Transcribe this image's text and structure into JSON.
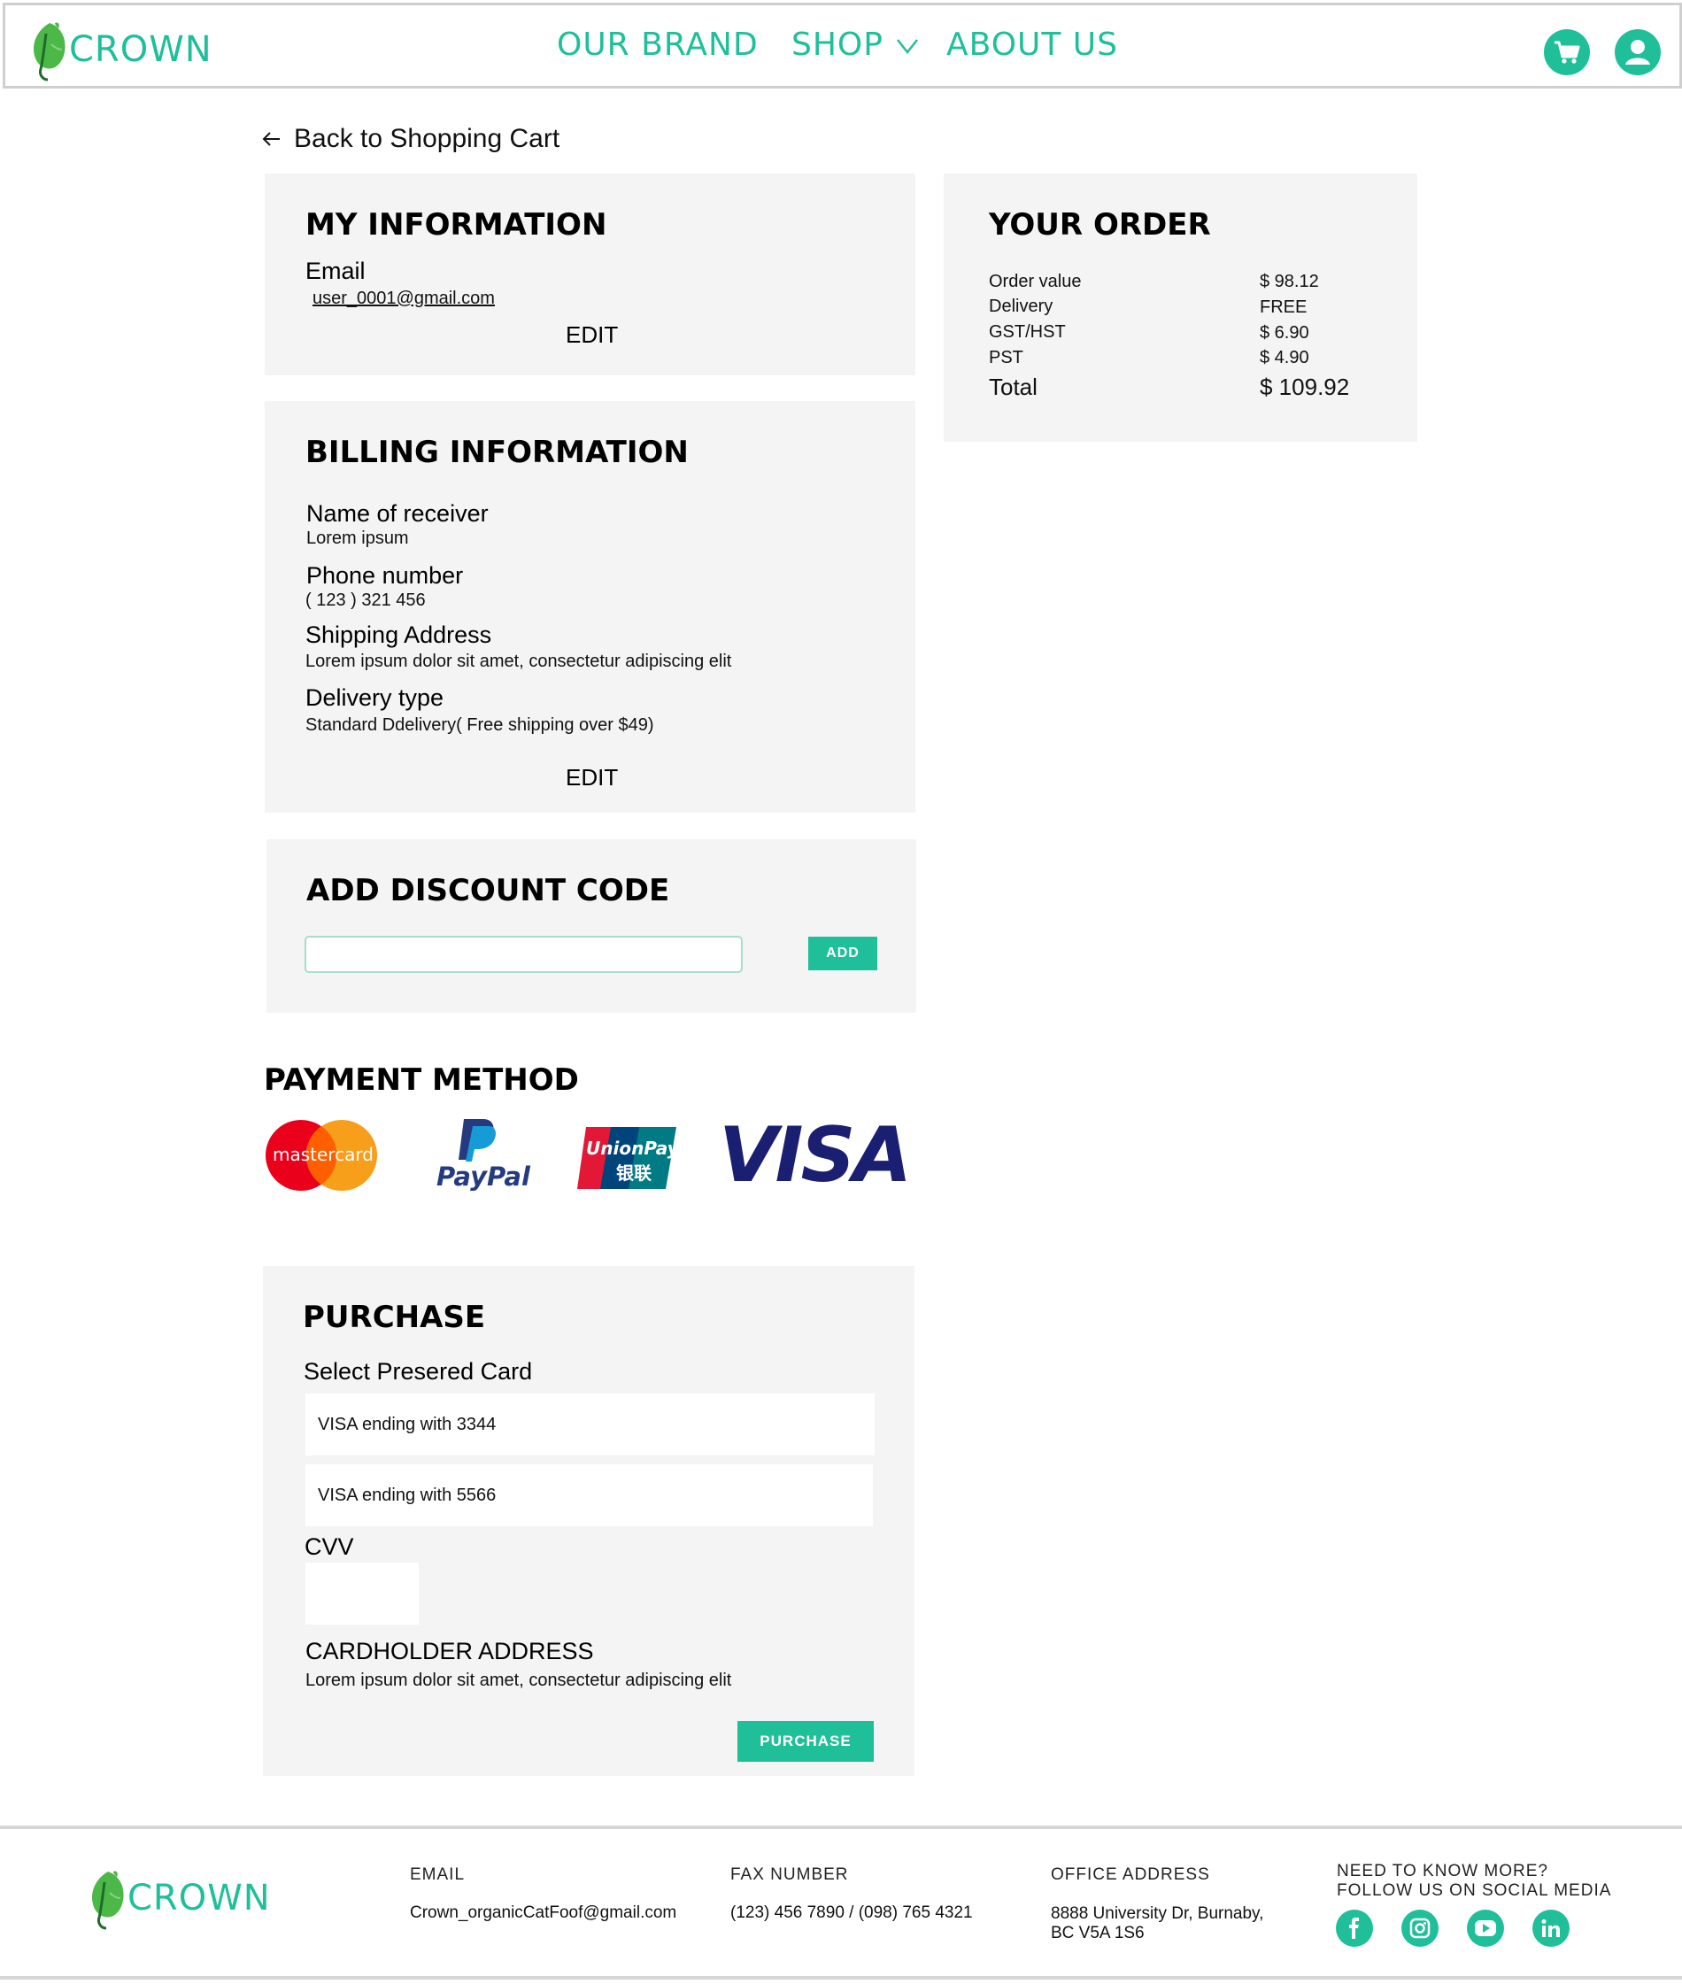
{
  "header": {
    "brand": "CROWN",
    "nav": [
      "OUR BRAND",
      "SHOP",
      "ABOUT US"
    ],
    "icons": [
      "cart-icon",
      "user-icon"
    ]
  },
  "back_link": "Back to Shopping Cart",
  "my_info": {
    "title": "MY INFORMATION",
    "email_label": "Email",
    "email_value": "user_0001@gmail.com",
    "edit": "EDIT"
  },
  "billing": {
    "title": "BILLING INFORMATION",
    "receiver_label": "Name of receiver",
    "receiver_value": "Lorem ipsum",
    "phone_label": "Phone number",
    "phone_value": "( 123 ) 321 456",
    "address_label": "Shipping Address",
    "address_value": "Lorem ipsum dolor sit amet, consectetur adipiscing elit",
    "delivery_label": "Delivery type",
    "delivery_value": "Standard Ddelivery( Free shipping over $49)",
    "edit": "EDIT"
  },
  "discount": {
    "title": "ADD DISCOUNT CODE",
    "input_value": "",
    "button": "ADD"
  },
  "payment": {
    "title": "PAYMENT METHOD",
    "methods": [
      "mastercard",
      "PayPal",
      "UnionPay",
      "VISA"
    ],
    "unionpay_cn": "银联"
  },
  "purchase": {
    "title": "PURCHASE",
    "select_label": "Select Presered Card",
    "cards": [
      "VISA ending with 3344",
      "VISA ending with 5566"
    ],
    "cvv_label": "CVV",
    "cardholder_label": "CARDHOLDER ADDRESS",
    "cardholder_value": "Lorem ipsum dolor sit amet, consectetur adipiscing elit",
    "button": "PURCHASE"
  },
  "order": {
    "title": "YOUR ORDER",
    "rows": [
      {
        "label": "Order value",
        "value": "$ 98.12"
      },
      {
        "label": "Delivery",
        "value": "FREE"
      },
      {
        "label": "GST/HST",
        "value": "$ 6.90"
      },
      {
        "label": "PST",
        "value": "$ 4.90"
      }
    ],
    "total_label": "Total",
    "total_value": "$ 109.92"
  },
  "footer": {
    "brand": "CROWN",
    "email_head": "EMAIL",
    "email_value": "Crown_organicCatFoof@gmail.com",
    "fax_head": "FAX NUMBER",
    "fax_value": "(123) 456 7890 / (098) 765 4321",
    "office_head": "OFFICE ADDRESS",
    "office_line1": "8888 University Dr, Burnaby,",
    "office_line2": "BC V5A 1S6",
    "social_head1": "NEED TO KNOW MORE?",
    "social_head2": "FOLLOW US ON SOCIAL MEDIA",
    "social_icons": [
      "facebook-icon",
      "instagram-icon",
      "youtube-icon",
      "linkedin-icon"
    ]
  },
  "colors": {
    "accent": "#1fbf9a",
    "panel_bg": "#f4f4f4",
    "leaf_green": "#4cb848"
  }
}
